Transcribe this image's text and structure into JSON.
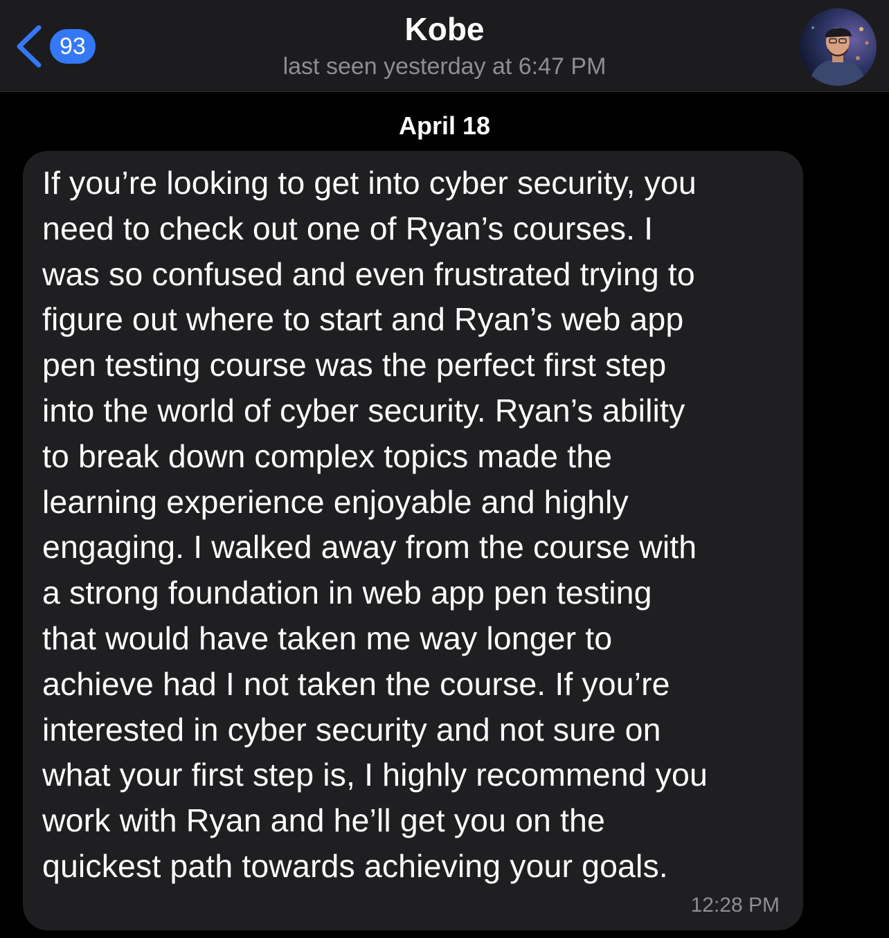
{
  "header": {
    "back_badge": "93",
    "contact_name": "Kobe",
    "contact_status": "last seen yesterday at 6:47 PM",
    "avatar_icon": "profile-photo",
    "back_icon": "chevron-left-icon"
  },
  "chat": {
    "date_divider": "April 18",
    "messages": [
      {
        "text": "If you’re looking to get into cyber security, you\nneed to check out one of Ryan’s courses. I\nwas so confused and even frustrated trying to\nfigure out where to start and Ryan’s web app\npen testing course was the perfect first step\ninto the world of cyber security. Ryan’s ability\nto break down complex topics made the\nlearning experience enjoyable and highly\nengaging. I walked away from the course with\na strong foundation in web app pen testing\nthat would have taken me way longer to\nachieve had I not taken the course. If you’re\ninterested in cyber security and not sure on\nwhat your first step is, I highly recommend you\nwork with Ryan and he’ll get you on the\nquickest path towards achieving your goals.",
        "time": "12:28 PM"
      }
    ]
  },
  "colors": {
    "accent": "#3478f6",
    "header_bg": "#1c1c1e",
    "bubble_bg": "#1f1f21",
    "secondary_text": "#8e8e93",
    "background": "#000000"
  }
}
